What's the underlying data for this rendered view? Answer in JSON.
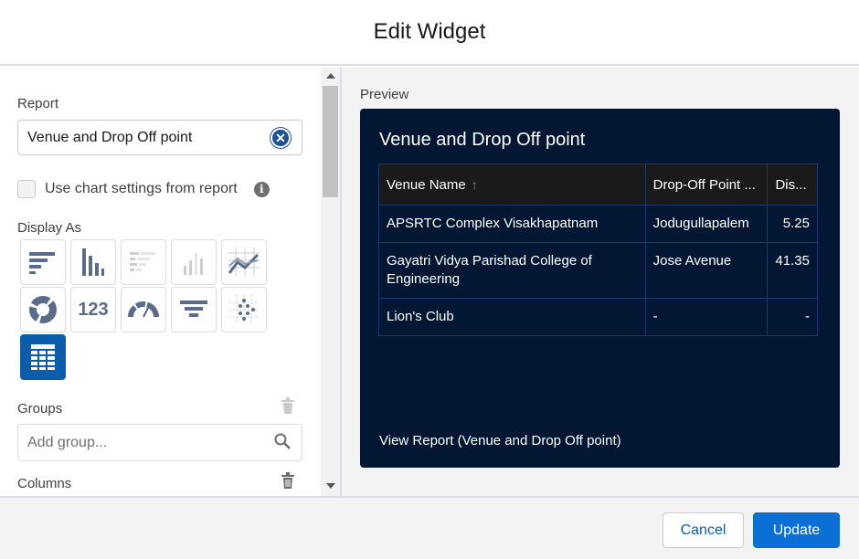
{
  "dialog": {
    "title": "Edit Widget"
  },
  "left_panel": {
    "report_label": "Report",
    "report_value": "Venue and Drop Off point",
    "use_chart_settings_label": "Use chart settings from report",
    "display_as_label": "Display As",
    "display_options": [
      {
        "icon": "horizontal-bar-chart-icon",
        "selected": false
      },
      {
        "icon": "vertical-bar-chart-icon",
        "selected": false
      },
      {
        "icon": "stacked-horizontal-bar-chart-icon",
        "selected": false
      },
      {
        "icon": "stacked-vertical-bar-chart-icon",
        "selected": false
      },
      {
        "icon": "line-chart-icon",
        "selected": false
      },
      {
        "icon": "donut-chart-icon",
        "selected": false
      },
      {
        "icon": "metric-icon",
        "text": "123",
        "selected": false
      },
      {
        "icon": "gauge-chart-icon",
        "selected": false
      },
      {
        "icon": "funnel-chart-icon",
        "selected": false
      },
      {
        "icon": "scatter-chart-icon",
        "selected": false
      },
      {
        "icon": "table-icon",
        "selected": true
      }
    ],
    "groups_label": "Groups",
    "groups_placeholder": "Add group...",
    "columns_label": "Columns"
  },
  "preview": {
    "label": "Preview",
    "card_title": "Venue and Drop Off point",
    "columns": [
      "Venue Name",
      "Drop-Off Point ...",
      "Dis..."
    ],
    "rows": [
      {
        "venue": "APSRTC Complex Visakhapatnam",
        "drop_off": "Jodugullapalem",
        "distance": "5.25"
      },
      {
        "venue": "Gayatri Vidya Parishad College of Engineering",
        "drop_off": "Jose Avenue",
        "distance": "41.35"
      },
      {
        "venue": "Lion's Club",
        "drop_off": "-",
        "distance": "-"
      }
    ],
    "view_report_link": "View Report (Venue and Drop Off point)"
  },
  "footer": {
    "cancel_label": "Cancel",
    "update_label": "Update"
  },
  "colors": {
    "accent": "#0b5cab",
    "card_bg": "#031634",
    "table_header_bg": "#1a1a1a"
  }
}
